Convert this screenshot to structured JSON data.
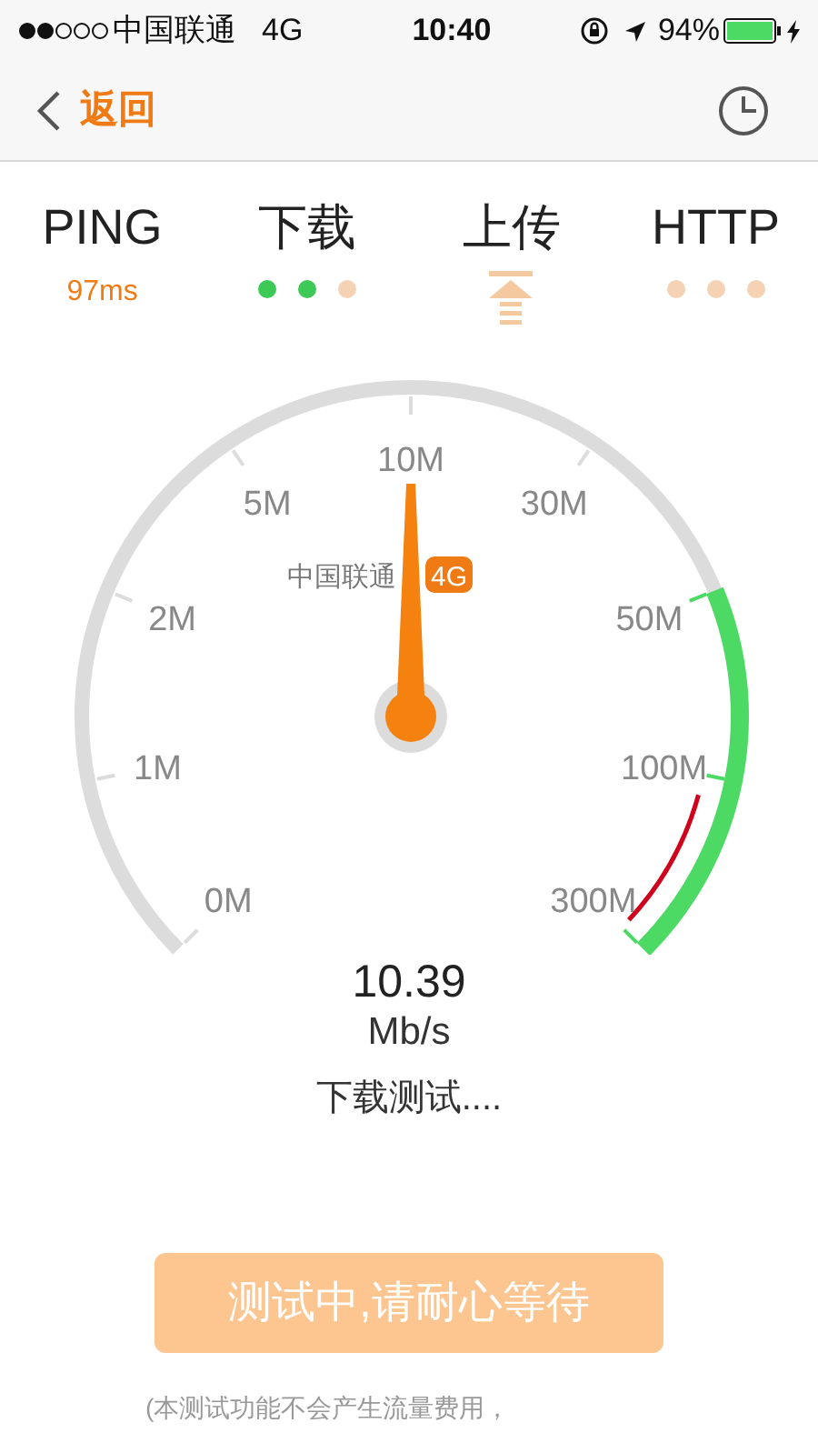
{
  "status_bar": {
    "carrier": "中国联通",
    "network": "4G",
    "time": "10:40",
    "battery_text": "94%"
  },
  "nav": {
    "back_label": "返回"
  },
  "tabs": [
    {
      "kind": "value",
      "label": "PING",
      "value": "97ms"
    },
    {
      "kind": "dots",
      "label": "下载",
      "dots": [
        {
          "done": true
        },
        {
          "done": true
        },
        {
          "done": false
        }
      ]
    },
    {
      "kind": "icon",
      "label": "上传"
    },
    {
      "kind": "dots",
      "label": "HTTP",
      "dots": [
        {
          "done": false
        },
        {
          "done": false
        },
        {
          "done": false
        }
      ]
    }
  ],
  "gauge": {
    "scale_labels": [
      "0M",
      "1M",
      "2M",
      "5M",
      "10M",
      "30M",
      "50M",
      "100M",
      "300M"
    ],
    "level": 0.5,
    "carrier": "中国联通",
    "network_badge": "4G",
    "speed": "10.39",
    "unit": "Mb/s",
    "status": "下载测试...."
  },
  "button": {
    "label": "测试中,请耐心等待",
    "disabled": true
  },
  "footnote": "(本测试功能不会产生流量费用，"
}
